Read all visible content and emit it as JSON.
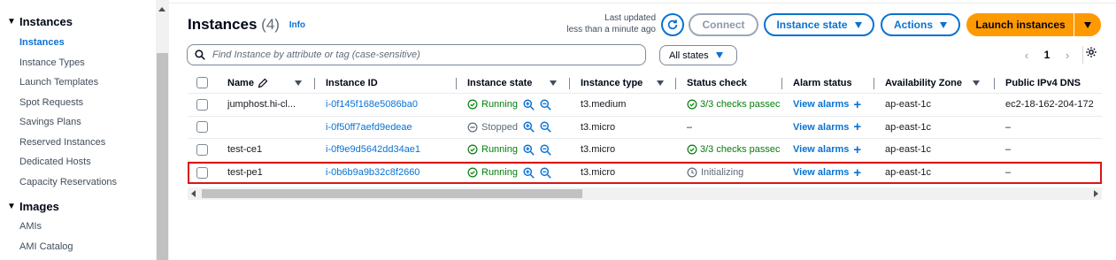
{
  "sidebar": {
    "sections": [
      {
        "title": "Instances",
        "items": [
          "Instances",
          "Instance Types",
          "Launch Templates",
          "Spot Requests",
          "Savings Plans",
          "Reserved Instances",
          "Dedicated Hosts",
          "Capacity Reservations"
        ]
      },
      {
        "title": "Images",
        "items": [
          "AMIs",
          "AMI Catalog"
        ]
      }
    ]
  },
  "header": {
    "title": "Instances",
    "count": "(4)",
    "info": "Info",
    "last_updated_line1": "Last updated",
    "last_updated_line2": "less than a minute ago",
    "connect": "Connect",
    "instance_state": "Instance state",
    "actions": "Actions",
    "launch": "Launch instances"
  },
  "filter": {
    "search_placeholder": "Find Instance by attribute or tag (case-sensitive)",
    "state_filter": "All states"
  },
  "pagination": {
    "current_page": "1"
  },
  "table": {
    "columns": [
      "Name",
      "Instance ID",
      "Instance state",
      "Instance type",
      "Status check",
      "Alarm status",
      "Availability Zone",
      "Public IPv4 DNS"
    ],
    "rows": [
      {
        "name": "jumphost.hi-cl...",
        "id": "i-0f145f168e5086ba0",
        "state": "Running",
        "type": "t3.medium",
        "status": "3/3 checks passec",
        "alarm": "View alarms",
        "az": "ap-east-1c",
        "dns": "ec2-18-162-204-172"
      },
      {
        "name": "",
        "id": "i-0f50ff7aefd9edeae",
        "state": "Stopped",
        "type": "t3.micro",
        "status": "–",
        "alarm": "View alarms",
        "az": "ap-east-1c",
        "dns": "–"
      },
      {
        "name": "test-ce1",
        "id": "i-0f9e9d5642dd34ae1",
        "state": "Running",
        "type": "t3.micro",
        "status": "3/3 checks passec",
        "alarm": "View alarms",
        "az": "ap-east-1c",
        "dns": "–"
      },
      {
        "name": "test-pe1",
        "id": "i-0b6b9a9b32c8f2660",
        "state": "Running",
        "type": "t3.micro",
        "status": "Initializing",
        "alarm": "View alarms",
        "az": "ap-east-1c",
        "dns": "–"
      }
    ]
  },
  "colors": {
    "link": "#0972d3",
    "running": "#037f0c",
    "primary": "#ff9900",
    "highlight": "#d91515"
  }
}
